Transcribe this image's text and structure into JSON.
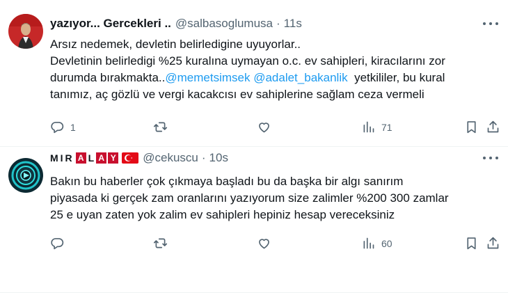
{
  "tweets": [
    {
      "display_name": "yazıyor... Gercekleri ..",
      "handle": "@salbasoglumusa",
      "separator": "·",
      "time": "11s",
      "lines": [
        "Arsız nedemek, devletin belirledigine uyuyorlar..",
        "Devletinin belirledigi %25 kuralına uymayan o.c. ev sahipleri, kiracılarını zor",
        "durumda bırakmakta..",
        "tanımız, aç gözlü ve vergi kacakcısı ev sahiplerine sağlam ceza vermeli"
      ],
      "mentions": [
        "@memetsimsek",
        "@adalet_bakanlik"
      ],
      "line3_tail": "yetkililer, bu kural",
      "reply_count": "1",
      "retweet_count": "",
      "like_count": "",
      "view_count": "71"
    },
    {
      "display_name_parts": [
        "MIR",
        "A",
        "L",
        "A",
        "Y",
        "C"
      ],
      "handle": "@cekuscu",
      "separator": "·",
      "time": "10s",
      "lines": [
        "Bakın bu haberler çok çıkmaya başladı bu da başka bir algı sanırım",
        "piyasada ki gerçek zam oranlarını yazıyorum size zalimler %200 300 zamlar",
        "25 e uyan zaten yok zalim ev sahipleri hepiniz hesap vereceksiniz"
      ],
      "reply_count": "",
      "retweet_count": "",
      "like_count": "",
      "view_count": "60"
    }
  ],
  "icons": {
    "reply": "reply-icon",
    "retweet": "retweet-icon",
    "like": "heart-icon",
    "views": "views-icon",
    "bookmark": "bookmark-icon",
    "share": "share-icon",
    "more": "more-icon"
  },
  "colors": {
    "text": "#0f1419",
    "secondary": "#536471",
    "link": "#1d9bf0",
    "border": "#eff3f4",
    "miralay_red": "#c8102e"
  }
}
